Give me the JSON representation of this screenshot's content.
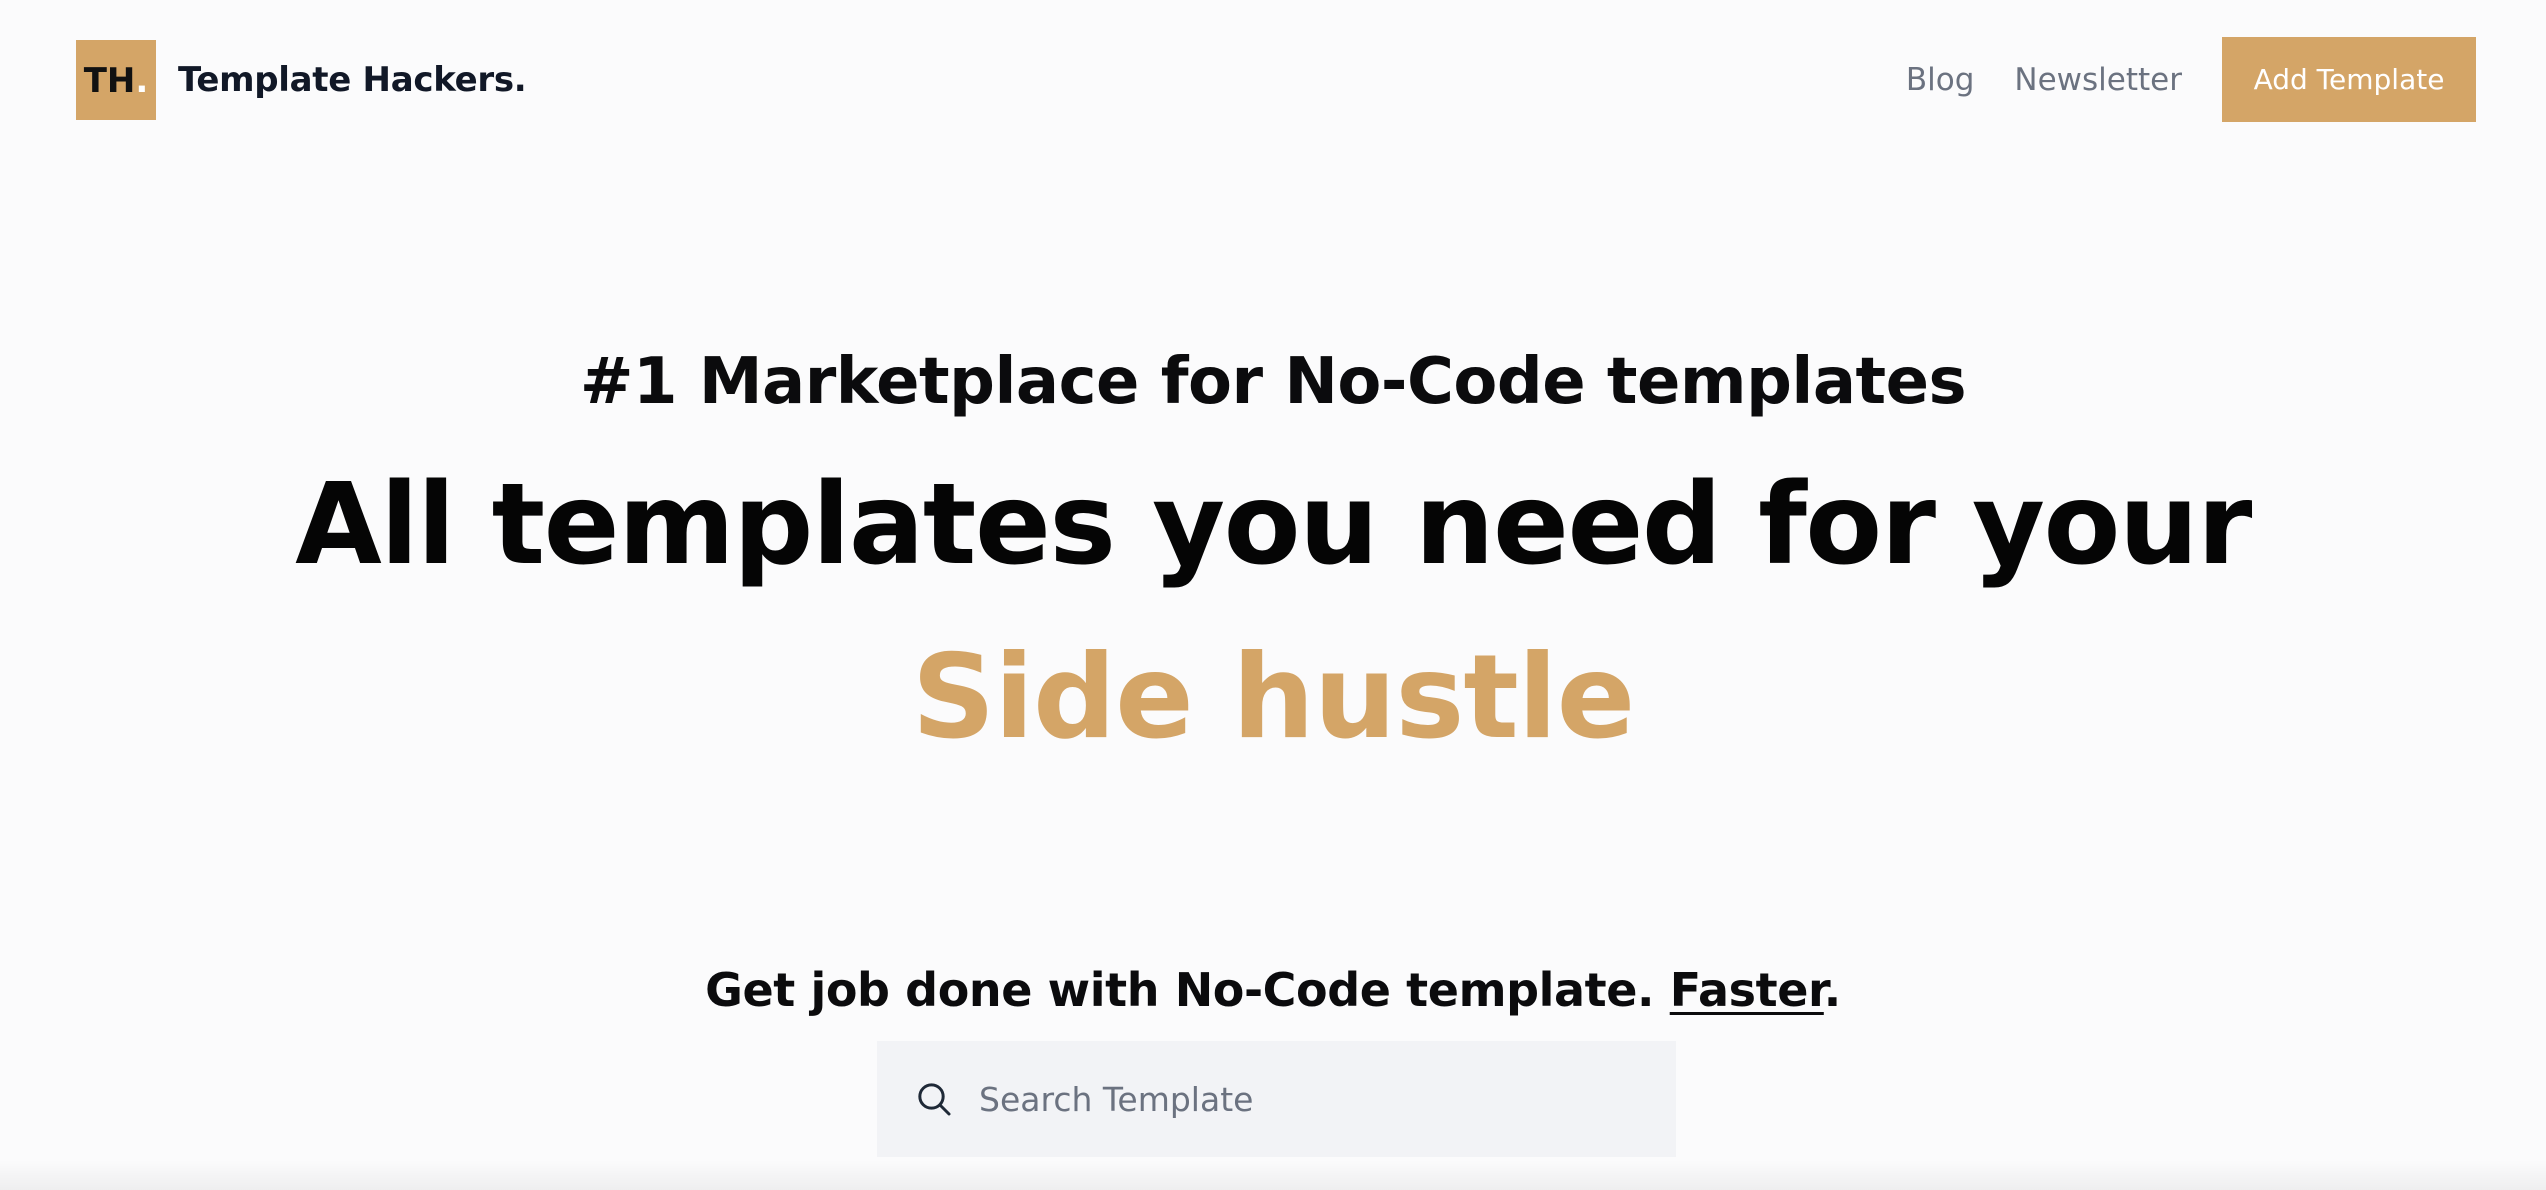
{
  "header": {
    "logo_text": "TH",
    "logo_dot": ".",
    "brand_name": "Template Hackers.",
    "nav": [
      {
        "label": "Blog"
      },
      {
        "label": "Newsletter"
      }
    ],
    "cta_label": "Add Template"
  },
  "hero": {
    "kicker": "#1 Marketplace for No-Code templates",
    "headline": "All templates you need for your",
    "accent": "Side hustle"
  },
  "search_section": {
    "subtitle_prefix": "Get job done with No-Code template. ",
    "subtitle_link": "Faster",
    "subtitle_suffix": ".",
    "search": {
      "placeholder": "Search Template",
      "value": ""
    }
  },
  "colors": {
    "accent": "#d4a567",
    "text": "#0b0b0d",
    "muted": "#6b7280",
    "search_bg": "#f2f3f6"
  },
  "icons": {
    "search": "search-icon"
  }
}
